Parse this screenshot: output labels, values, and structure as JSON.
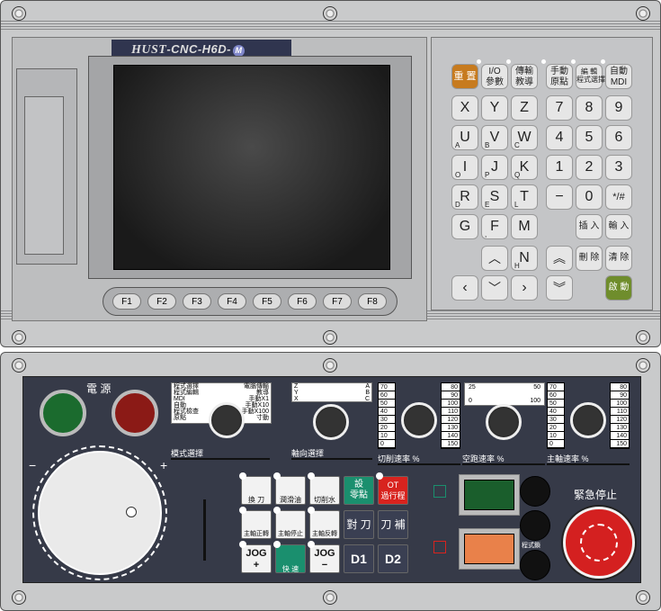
{
  "logo": {
    "brand": "HUST",
    "model": "-CNC-H6D-",
    "badge": "M"
  },
  "fkeys": [
    "F1",
    "F2",
    "F3",
    "F4",
    "F5",
    "F6",
    "F7",
    "F8"
  ],
  "keypad": {
    "row1": [
      {
        "label": "重 置"
      },
      {
        "label": "I/O\n參數"
      },
      {
        "label": "傳輸\n教導"
      },
      {
        "label": "手動\n原點"
      },
      {
        "label": "編 輯\n程式選擇"
      },
      {
        "label": "自動\nMDI"
      }
    ],
    "letters": [
      [
        "X",
        "",
        "Y",
        "",
        "Z",
        ""
      ],
      [
        "U",
        "A",
        "V",
        "B",
        "W",
        "C"
      ],
      [
        "I",
        "O",
        "J",
        "P",
        "K",
        "Q"
      ],
      [
        "R",
        "D",
        "S",
        "E",
        "T",
        "L"
      ],
      [
        "G",
        "",
        "F",
        ",",
        "M",
        ""
      ]
    ],
    "digits": [
      [
        "7",
        "8",
        "9"
      ],
      [
        "4",
        "5",
        "6"
      ],
      [
        "1",
        "2",
        "3"
      ],
      [
        "−",
        "0",
        "*/#"
      ]
    ],
    "insert": "插 入",
    "input": "輸 入",
    "delete": "刪 除",
    "clear": "清 除",
    "start": "啟 動",
    "n_key": "N",
    "n_sub": "H"
  },
  "lower": {
    "power": "電 源",
    "mode_labels": [
      "程式選擇",
      "程式編輯",
      "MDI",
      "自動",
      "程式檢查",
      "原點",
      "電腦傳輸",
      "教導",
      "手動X1",
      "手動X10",
      "手動X100",
      "寸動"
    ],
    "mode_title": "模式選擇",
    "axis_labels": [
      "Z",
      "Y",
      "X",
      "A",
      "B",
      "C"
    ],
    "axis_title": "軸向選擇",
    "feed_left": [
      "70",
      "60",
      "50",
      "40",
      "30",
      "20",
      "10",
      "0"
    ],
    "feed_right": [
      "80",
      "90",
      "100",
      "110",
      "120",
      "130",
      "140",
      "150"
    ],
    "feed_title": "切削速率 %",
    "rapid_labels": [
      "25",
      "50",
      "0",
      "100"
    ],
    "rapid_title": "空跑速率 %",
    "spindle_left": [
      "70",
      "60",
      "50",
      "40",
      "30",
      "20",
      "10",
      "0"
    ],
    "spindle_right": [
      "80",
      "90",
      "100",
      "110",
      "120",
      "130",
      "140",
      "150"
    ],
    "spindle_title": "主軸速率 %",
    "buttons": {
      "tool_change": "換 刀",
      "lube": "潤滑油",
      "coolant": "切削水",
      "set_zero": "設\n零點",
      "ot": "OT\n過行程",
      "spindle_cw": "主軸正轉",
      "spindle_stop": "主軸停止",
      "spindle_ccw": "主軸反轉",
      "tool_set": "對 刀",
      "tool_comp": "刀 補",
      "jog_plus": "JOG\n+",
      "rapid": "快 速",
      "jog_minus": "JOG\n−",
      "d1": "D1",
      "d2": "D2"
    },
    "estop": "緊急停止",
    "program_lock": "程式鎖",
    "plus": "+",
    "minus": "−"
  },
  "colors": {
    "accent_orange": "#c77b1f",
    "start_green": "#6f8d2c",
    "panel_dark": "#363a48",
    "estop_red": "#d42020",
    "set_zero_green": "#1a8f6e",
    "ot_red": "#d8231e"
  }
}
